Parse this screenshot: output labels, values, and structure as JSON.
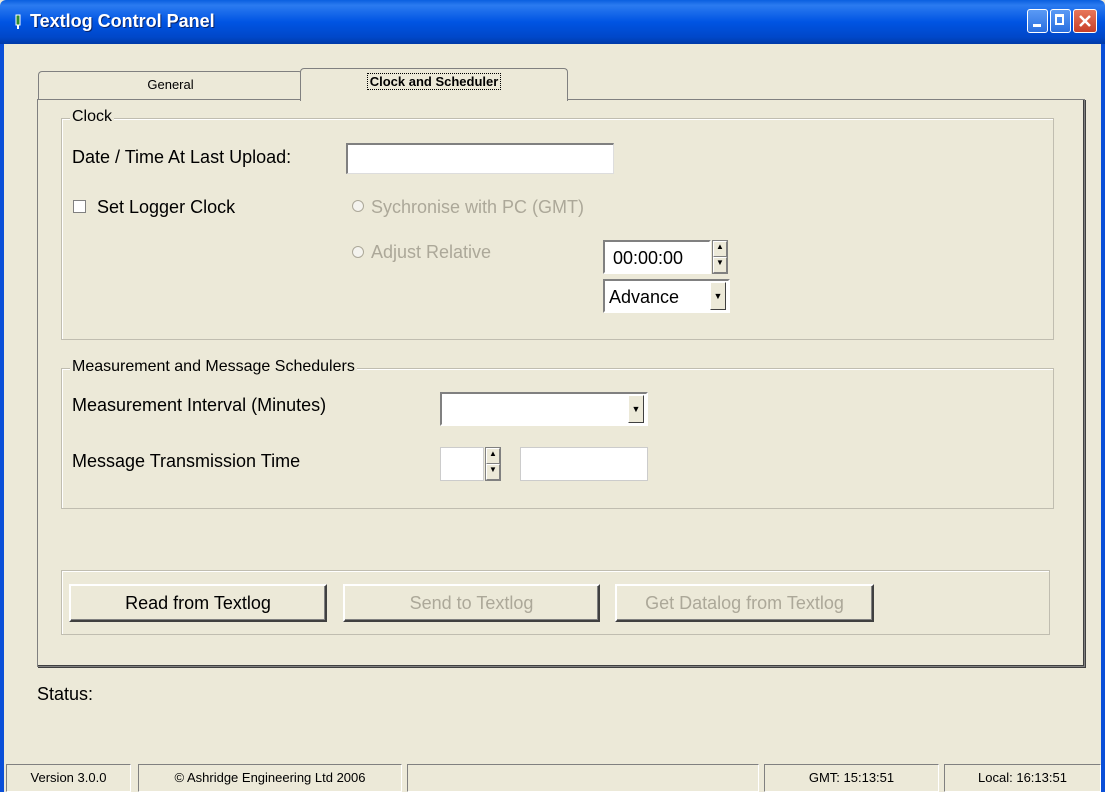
{
  "window": {
    "title": "Textlog Control Panel"
  },
  "tabs": [
    {
      "label": "General"
    },
    {
      "label": "Clock and Scheduler"
    }
  ],
  "clock": {
    "group_label": "Clock",
    "last_upload_label": "Date / Time At Last Upload:",
    "last_upload_value": "",
    "set_logger_clock_label": "Set Logger Clock",
    "sync_pc_label": "Sychronise with PC (GMT)",
    "adjust_relative_label": "Adjust Relative",
    "adjust_time_value": "00:00:00",
    "adjust_direction_value": "Advance"
  },
  "schedulers": {
    "group_label": "Measurement and Message Schedulers",
    "measurement_interval_label": "Measurement Interval (Minutes)",
    "measurement_interval_value": "",
    "message_time_label": "Message Transmission Time",
    "message_time_value": "",
    "message_time_extra_value": ""
  },
  "actions": {
    "read_label": "Read from Textlog",
    "send_label": "Send to Textlog",
    "get_datalog_label": "Get Datalog from Textlog"
  },
  "status": {
    "label": "Status:"
  },
  "statusbar": {
    "version": "Version 3.0.0",
    "copyright": "© Ashridge Engineering Ltd 2006",
    "message": "",
    "gmt": "GMT: 15:13:51",
    "local": "Local: 16:13:51"
  }
}
